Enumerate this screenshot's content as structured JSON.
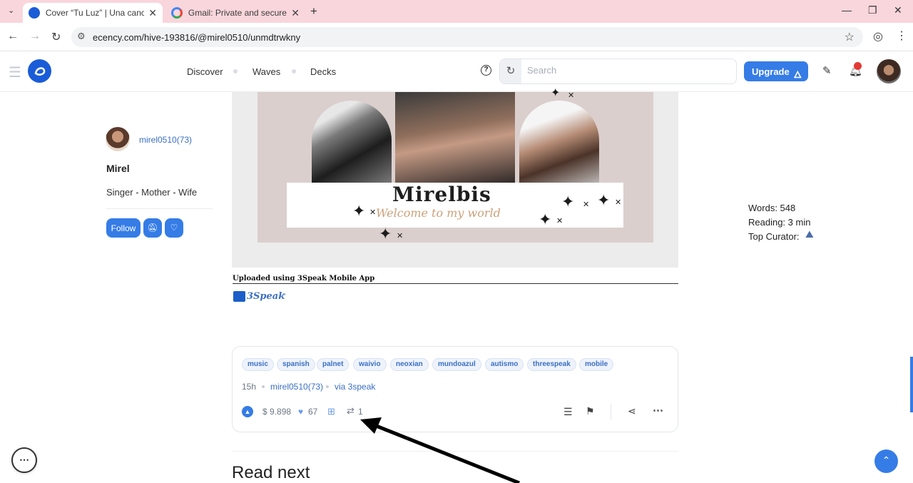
{
  "browser": {
    "tabs": [
      {
        "title": "Cover “Tu Luz” | Una canción sobre",
        "active": true
      },
      {
        "title": "Gmail: Private and secure email at",
        "active": false
      }
    ],
    "url": "ecency.com/hive-193816/@mirel0510/unmdtrwkny"
  },
  "header": {
    "nav": [
      "Discover",
      "Waves",
      "Decks"
    ],
    "search_placeholder": "Search",
    "upgrade_label": "Upgrade"
  },
  "author": {
    "handle": "mirel0510(73)",
    "name": "Mirel",
    "bio": "Singer - Mother - Wife",
    "follow_label": "Follow"
  },
  "banner": {
    "title": "Mirelbis",
    "subtitle": "Welcome to my world"
  },
  "post": {
    "upload_note": "Uploaded using 3Speak Mobile App",
    "link_label": "3Speak"
  },
  "stats": {
    "words": "Words: 548",
    "reading": "Reading: 3 min",
    "curator_label": "Top Curator:"
  },
  "tags": [
    "music",
    "spanish",
    "palnet",
    "waivio",
    "neoxian",
    "mundoazul",
    "autismo",
    "threespeak",
    "mobile"
  ],
  "meta": {
    "age": "15h",
    "author": "mirel0510(73)",
    "via": "via 3speak"
  },
  "actions": {
    "payout": "$ 9.898",
    "votes": "67",
    "reblogs": "1"
  },
  "read_next": "Read next",
  "colors": {
    "brand": "#357ce6",
    "tabbar": "#f9d6dc",
    "link": "#3a6fc4"
  }
}
